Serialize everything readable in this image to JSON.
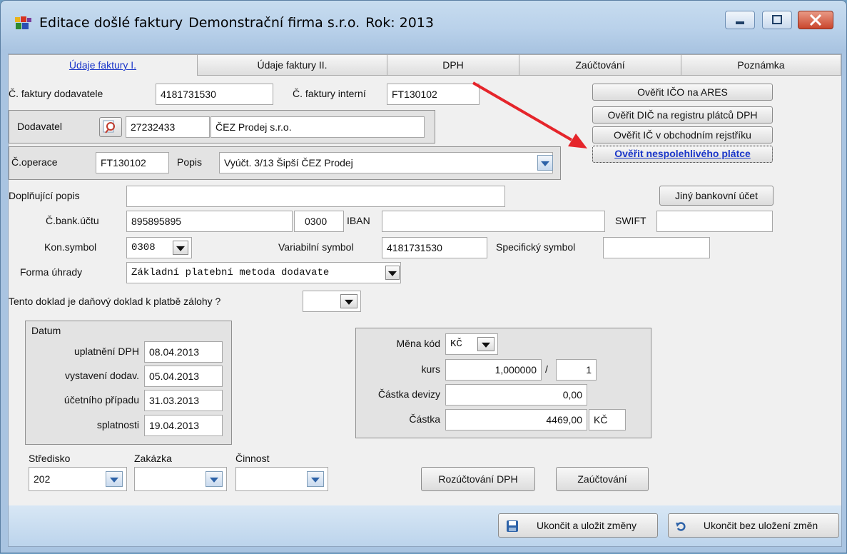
{
  "window": {
    "title": "Editace došlé faktury",
    "company": "Demonstrační firma s.r.o.",
    "year": "Rok: 2013"
  },
  "tabs": [
    "Údaje faktury I.",
    "Údaje faktury II.",
    "DPH",
    "Zaúčtování",
    "Poznámka"
  ],
  "invoice": {
    "supplier_no_label": "Č. faktury dodavatele",
    "supplier_no": "4181731530",
    "internal_no_label": "Č. faktury interní",
    "internal_no": "FT130102",
    "supplier_label": "Dodavatel",
    "supplier_ico": "27232433",
    "supplier_name": "ČEZ Prodej s.r.o.",
    "operation_label": "Č.operace",
    "operation": "FT130102",
    "desc_label": "Popis",
    "desc": "Vyúčt. 3/13 Šipší ČEZ Prodej",
    "extra_desc_label": "Doplňující popis",
    "extra_desc": "",
    "bank_label": "Č.bank.účtu",
    "bank_account": "895895895",
    "bank_code": "0300",
    "iban_label": "IBAN",
    "iban": "",
    "swift_label": "SWIFT",
    "swift": "",
    "konsym_label": "Kon.symbol",
    "konsym": "0308",
    "varsym_label": "Variabilní symbol",
    "varsym": "4181731530",
    "specsym_label": "Specifický symbol",
    "specsym": "",
    "payment_label": "Forma úhrady",
    "payment": "Základní platební metoda dodavate",
    "advance_label": "Tento doklad je daňový doklad k platbě zálohy ?",
    "advance": ""
  },
  "verify_buttons": [
    "Ověřit IČO na ARES",
    "Ověřit DIČ na registru plátců DPH",
    "Ověřit IČ v obchodním rejstříku",
    "Ověřit nespolehlivého plátce"
  ],
  "other_bank_button": "Jiný bankovní účet",
  "dates": {
    "title": "Datum",
    "rows": [
      {
        "label": "uplatnění DPH",
        "value": "08.04.2013"
      },
      {
        "label": "vystavení dodav.",
        "value": "05.04.2013"
      },
      {
        "label": "účetního případu",
        "value": "31.03.2013"
      },
      {
        "label": "splatnosti",
        "value": "19.04.2013"
      }
    ]
  },
  "currency": {
    "code_label": "Měna kód",
    "code": "KČ",
    "rate_label": "kurs",
    "rate": "1,000000",
    "rate_sep": "/",
    "rate_units": "1",
    "foreign_label": "Částka devizy",
    "foreign": "0,00",
    "amount_label": "Částka",
    "amount": "4469,00",
    "amount_currency": "KČ"
  },
  "codes": {
    "center_label": "Středisko",
    "center": "202",
    "order_label": "Zakázka",
    "order": "",
    "activity_label": "Činnost",
    "activity": ""
  },
  "actions": {
    "vat_split": "Rozúčtování DPH",
    "posting": "Zaúčtování",
    "save_exit": "Ukončit a uložit změny",
    "exit_nosave": "Ukončit bez uložení změn"
  },
  "colors": {
    "link": "#1a36c9",
    "arrow": "#e5252b"
  }
}
